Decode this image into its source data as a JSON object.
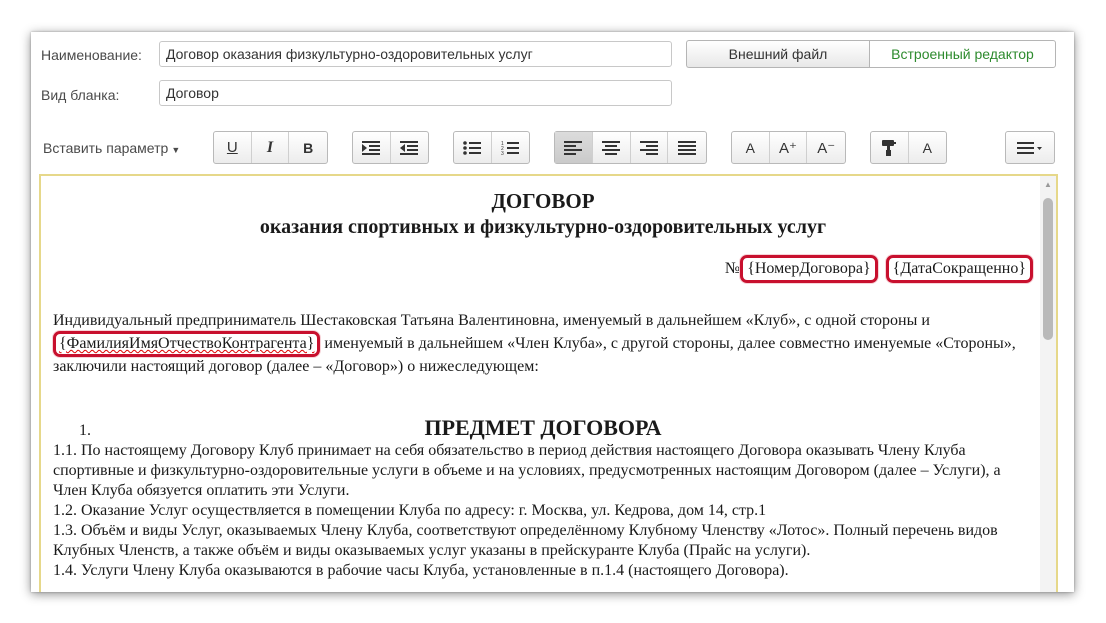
{
  "form": {
    "name_label": "Наименование:",
    "name_value": "Договор оказания физкультурно-оздоровительных услуг",
    "blank_label": "Вид бланка:",
    "blank_value": "Договор",
    "external_file": "Внешний файл",
    "builtin_editor": "Встроенный редактор"
  },
  "toolbar": {
    "insert_param": "Вставить параметр",
    "underline": "U",
    "italic": "I",
    "bold": "B",
    "font_a": "A",
    "font_plus": "A⁺",
    "font_minus": "A⁻",
    "text_color_a": "A"
  },
  "doc": {
    "title": "ДОГОВОР",
    "subtitle": "оказания спортивных и физкультурно-оздоровительных услуг",
    "num_prefix": "№",
    "param_contract_no": "{НомерДоговора}",
    "param_date": "{ДатаСокращенно}",
    "intro_1": "Индивидуальный предприниматель Шестаковская Татьяна Валентиновна, именуемый в дальнейшем «Клуб», с одной стороны и ",
    "param_name": "{ФамилияИмяОтчествоКонтрагента}",
    "intro_2": " именуемый в дальнейшем «Член Клуба», с другой стороны, далее совместно именуемые «Стороны», заключили настоящий договор (далее – «Договор») о нижеследующем:",
    "sec1_num": "1.",
    "sec1_title": "ПРЕДМЕТ ДОГОВОРА",
    "p1_1": "1.1. По настоящему Договору Клуб принимает на себя обязательство в период действия настоящего Договора оказывать Члену Клуба спортивные и физкультурно-оздоровительные услуги в объеме и на условиях, предусмотренных настоящим Договором (далее – Услуги), а Член Клуба обязуется оплатить эти Услуги.",
    "p1_2": "1.2. Оказание Услуг осуществляется в помещении Клуба по адресу: г. Москва, ул. Кедрова, дом 14, стр.1",
    "p1_3": "1.3. Объём и виды Услуг, оказываемых Члену Клуба, соответствуют определённому Клубному Членству «Лотос». Полный перечень видов Клубных Членств, а также объём и виды оказываемых услуг указаны в прейскуранте Клуба (Прайс на услуги).",
    "p1_4": "1.4. Услуги Члену Клуба оказываются в рабочие часы Клуба, установленные в п.1.4 (настоящего Договора)."
  },
  "colors": {
    "highlight": "#c8102e",
    "editor_border": "#e6d88a",
    "active_tab_text": "#2e8b2e"
  }
}
